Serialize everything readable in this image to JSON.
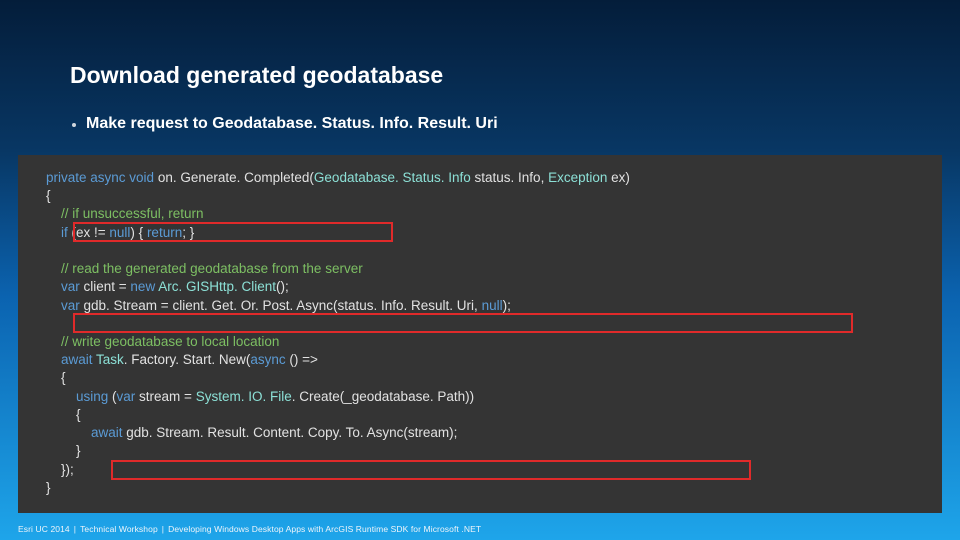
{
  "title": "Download generated geodatabase",
  "bullet": "Make request to Geodatabase. Status. Info. Result. Uri",
  "code": {
    "l1_a": "private",
    "l1_b": " async void",
    "l1_c": " on. Generate. Completed(",
    "l1_d": "Geodatabase. Status. Info",
    "l1_e": " status. Info, ",
    "l1_f": "Exception",
    "l1_g": " ex)",
    "l2": "{",
    "l3": "    // if unsuccessful, return",
    "l4_a": "    if",
    "l4_b": " (ex != ",
    "l4_c": "null",
    "l4_d": ") { ",
    "l4_e": "return",
    "l4_f": "; }",
    "l5": " ",
    "l6": "    // read the generated geodatabase from the server",
    "l7_a": "    var",
    "l7_b": " client = ",
    "l7_c": "new",
    "l7_d": " Arc. GISHttp. Client",
    "l7_e": "();",
    "l8_a": "    var",
    "l8_b": " gdb. Stream = client. Get. Or. Post. Async(status. Info. Result. Uri, ",
    "l8_c": "null",
    "l8_d": ");",
    "l9": " ",
    "l10": "    // write geodatabase to local location",
    "l11_a": "    await",
    "l11_b": " Task",
    "l11_c": ". Factory. Start. New(",
    "l11_d": "async",
    "l11_e": " () =>",
    "l12": "    {",
    "l13_a": "        using",
    "l13_b": " (",
    "l13_c": "var",
    "l13_d": " stream = ",
    "l13_e": "System. IO. File",
    "l13_f": ". Create(_geodatabase. Path))",
    "l14": "        {",
    "l15_a": "            await",
    "l15_b": " gdb. Stream. Result. Content. Copy. To. Async(stream);",
    "l16": "        }",
    "l17": "    });",
    "l18": "}"
  },
  "footer": {
    "a": "Esri UC 2014",
    "b": "Technical Workshop",
    "c": "Developing Windows Desktop Apps with ArcGIS Runtime SDK for Microsoft .NET"
  }
}
